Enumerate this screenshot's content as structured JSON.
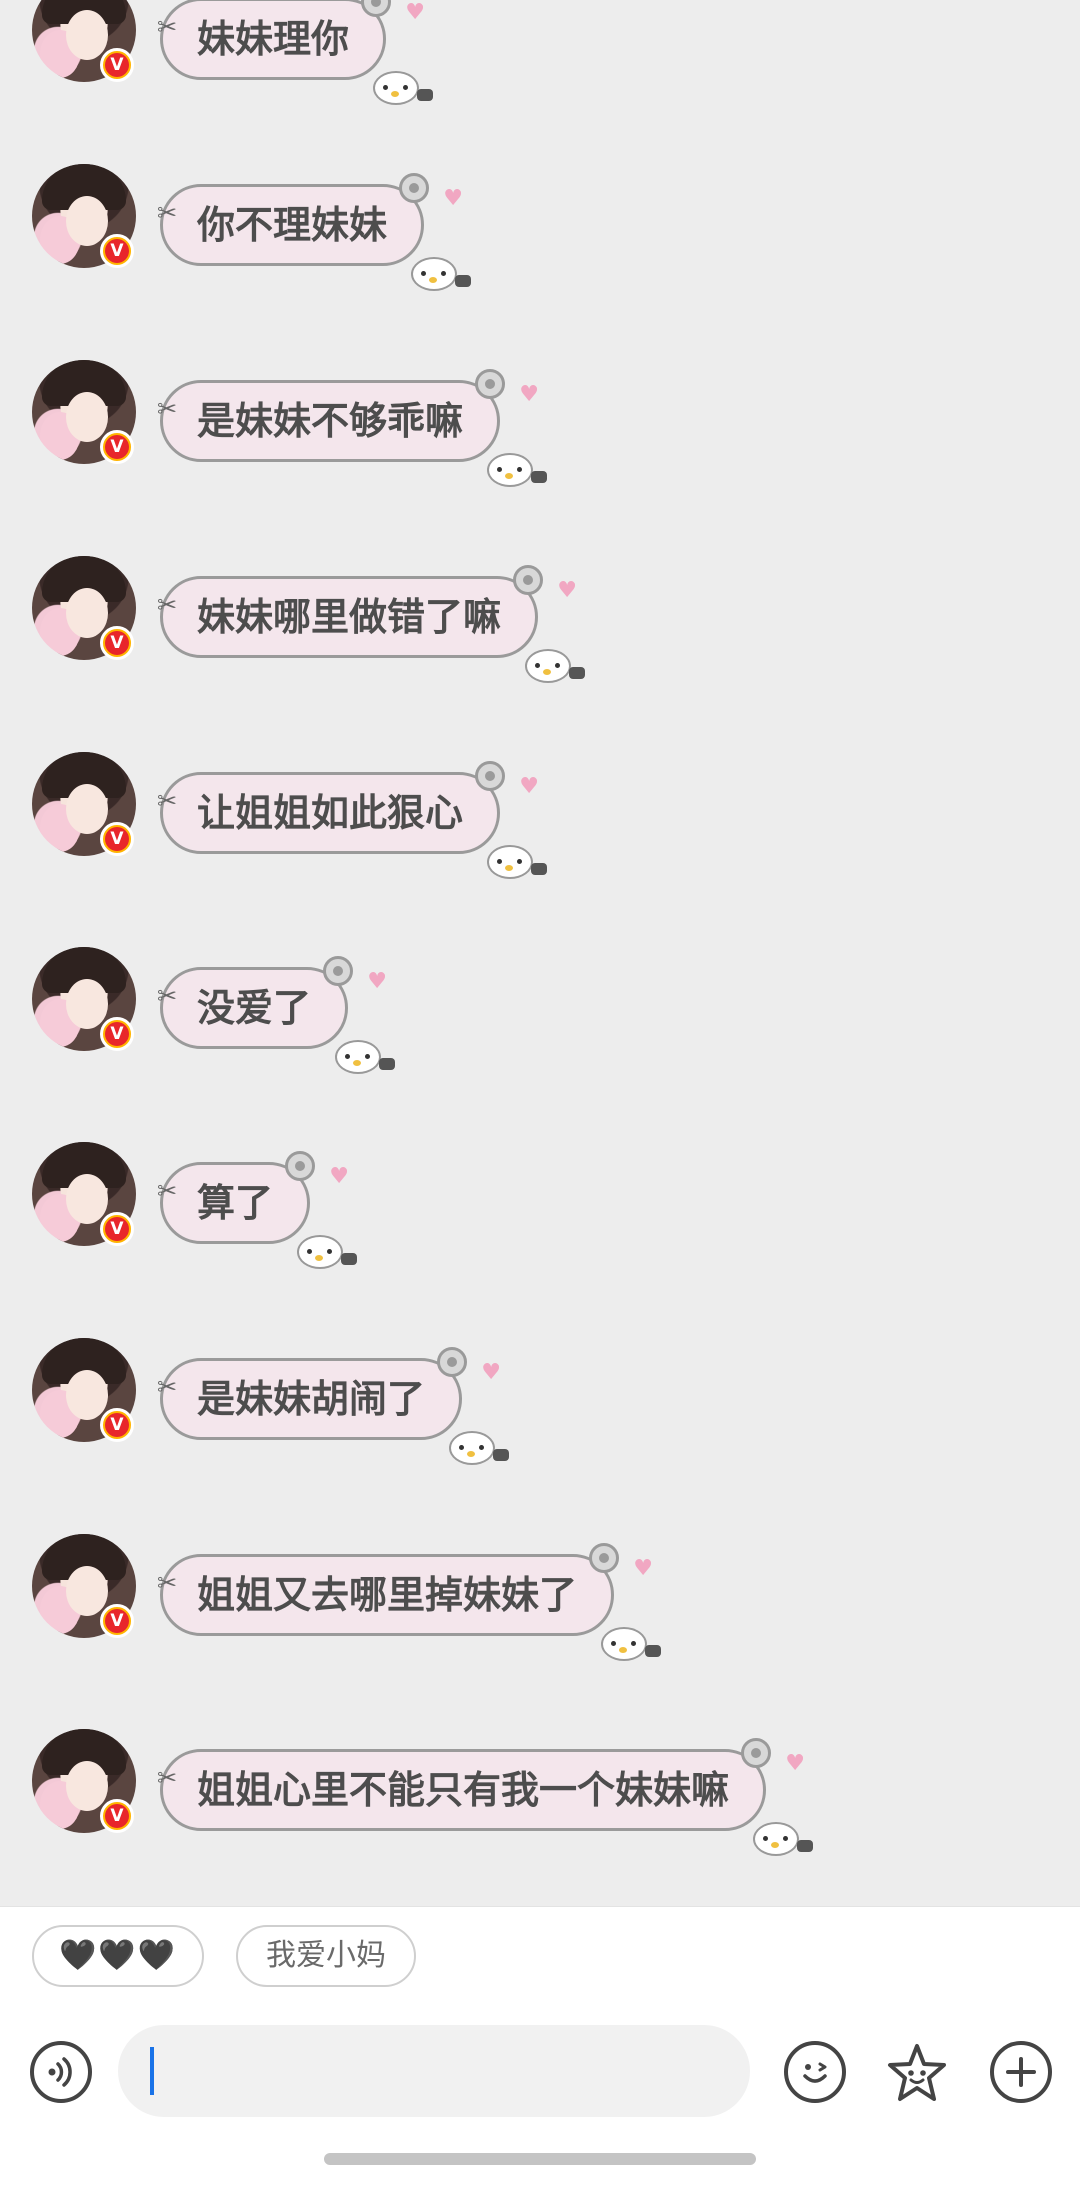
{
  "messages": [
    {
      "text": "妹妹理你"
    },
    {
      "text": "你不理妹妹"
    },
    {
      "text": "是妹妹不够乖嘛"
    },
    {
      "text": "妹妹哪里做错了嘛"
    },
    {
      "text": "让姐姐如此狠心"
    },
    {
      "text": "没爱了"
    },
    {
      "text": "算了"
    },
    {
      "text": "是妹妹胡闹了"
    },
    {
      "text": "姐姐又去哪里掉妹妹了"
    },
    {
      "text": "姐姐心里不能只有我一个妹妹嘛"
    }
  ],
  "badge": {
    "text": "V"
  },
  "quick_replies": [
    "🖤🖤🖤",
    "我爱小妈"
  ],
  "input": {
    "value": ""
  },
  "colors": {
    "bubble_bg": "#f4e6ec",
    "bubble_border": "#9a9a9a",
    "badge": "#ffb400",
    "caret": "#1a73e8"
  }
}
